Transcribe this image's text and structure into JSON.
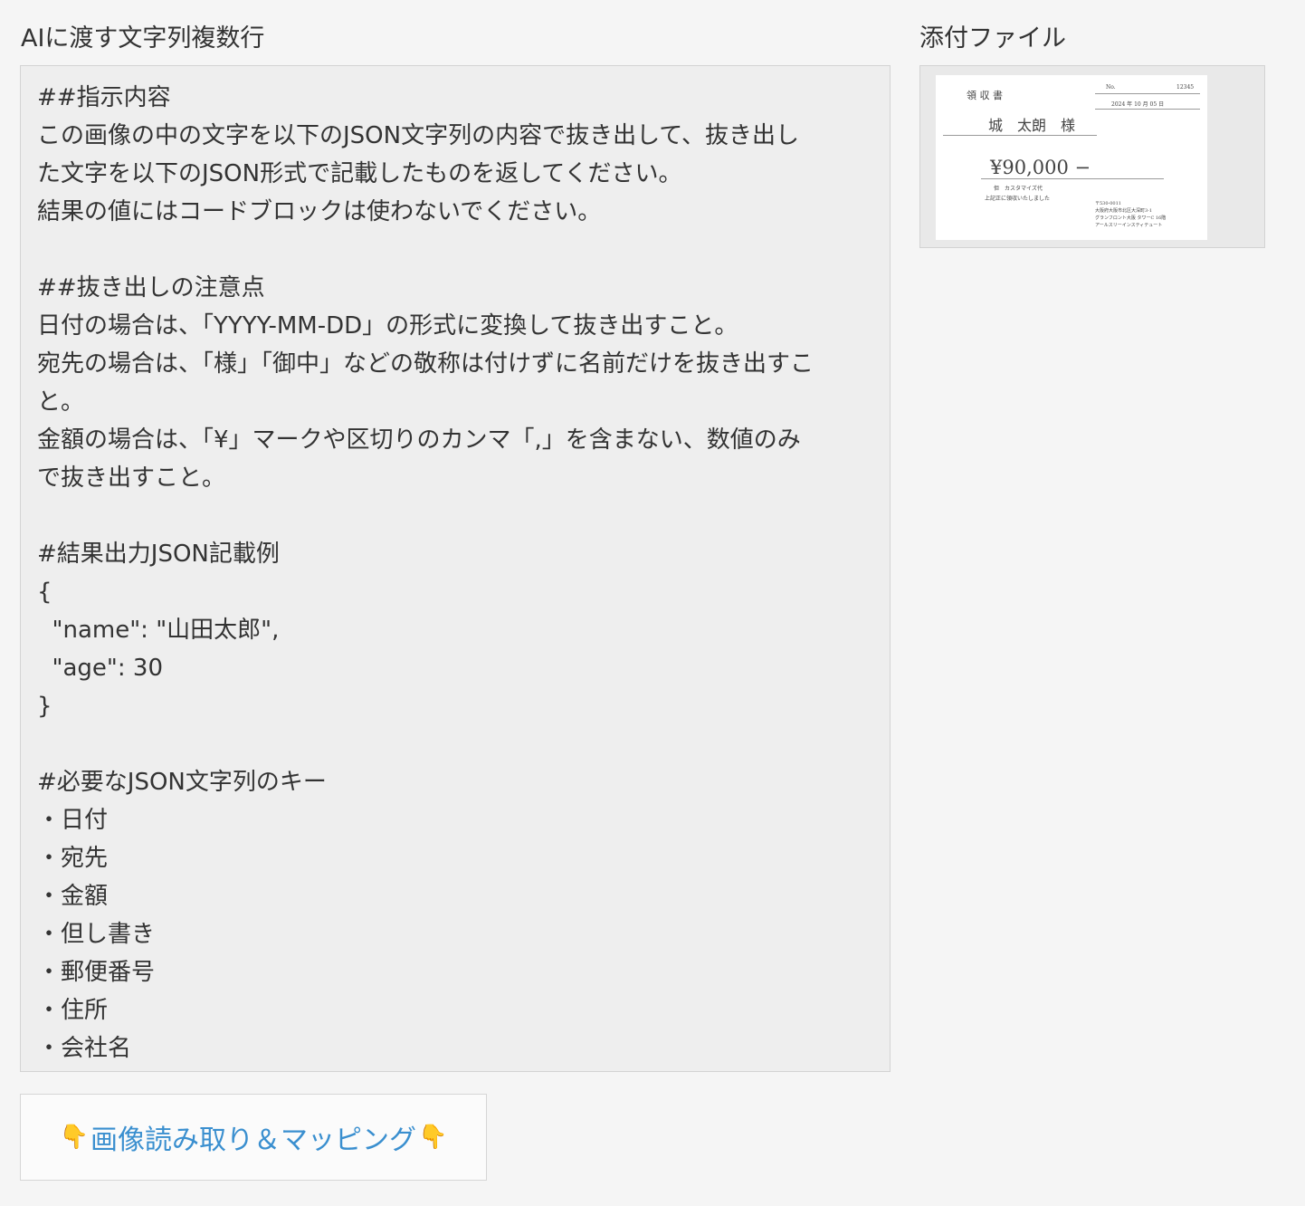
{
  "prompt_section": {
    "label": "AIに渡す文字列複数行",
    "lines": [
      "##指示内容",
      "この画像の中の文字を以下のJSON文字列の内容で抜き出して、抜き出し",
      "た文字を以下のJSON形式で記載したものを返してください。",
      "結果の値にはコードブロックは使わないでください。",
      "",
      "##抜き出しの注意点",
      "日付の場合は、「YYYY-MM-DD」の形式に変換して抜き出すこと。",
      "宛先の場合は、「様」「御中」などの敬称は付けずに名前だけを抜き出すこ",
      "と。",
      "金額の場合は、「¥」マークや区切りのカンマ「,」を含まない、数値のみ",
      "で抜き出すこと。",
      "",
      "#結果出力JSON記載例",
      "{",
      "  \"name\": \"山田太郎\",",
      "  \"age\": 30",
      "}",
      "",
      "#必要なJSON文字列のキー",
      "・日付",
      "・宛先",
      "・金額",
      "・但し書き",
      "・郵便番号",
      "・住所",
      "・会社名"
    ]
  },
  "attachment_section": {
    "label": "添付ファイル",
    "thumbnail": {
      "title": "領 収 書",
      "no_label": "No.",
      "no_value": "12345",
      "date": "2024 年 10 月 05 日",
      "recipient": "城　太朗　様",
      "amount": "¥90,000 −",
      "note_1": "但　カスタマイズ代",
      "note_2": "上記正に領収いたしました",
      "address_1": "〒530-0011",
      "address_2": "大阪府大阪市北区大深町3-1",
      "address_3": "グランフロント大阪 タワーC 16階",
      "address_4": "アールスリーインスティテュート"
    }
  },
  "action": {
    "button_label": "画像読み取り＆マッピング",
    "hand_icon": "👇"
  },
  "colors": {
    "button_text": "#3a8fcf",
    "page_bg": "#f5f5f5",
    "textarea_bg": "#eeeeee"
  }
}
